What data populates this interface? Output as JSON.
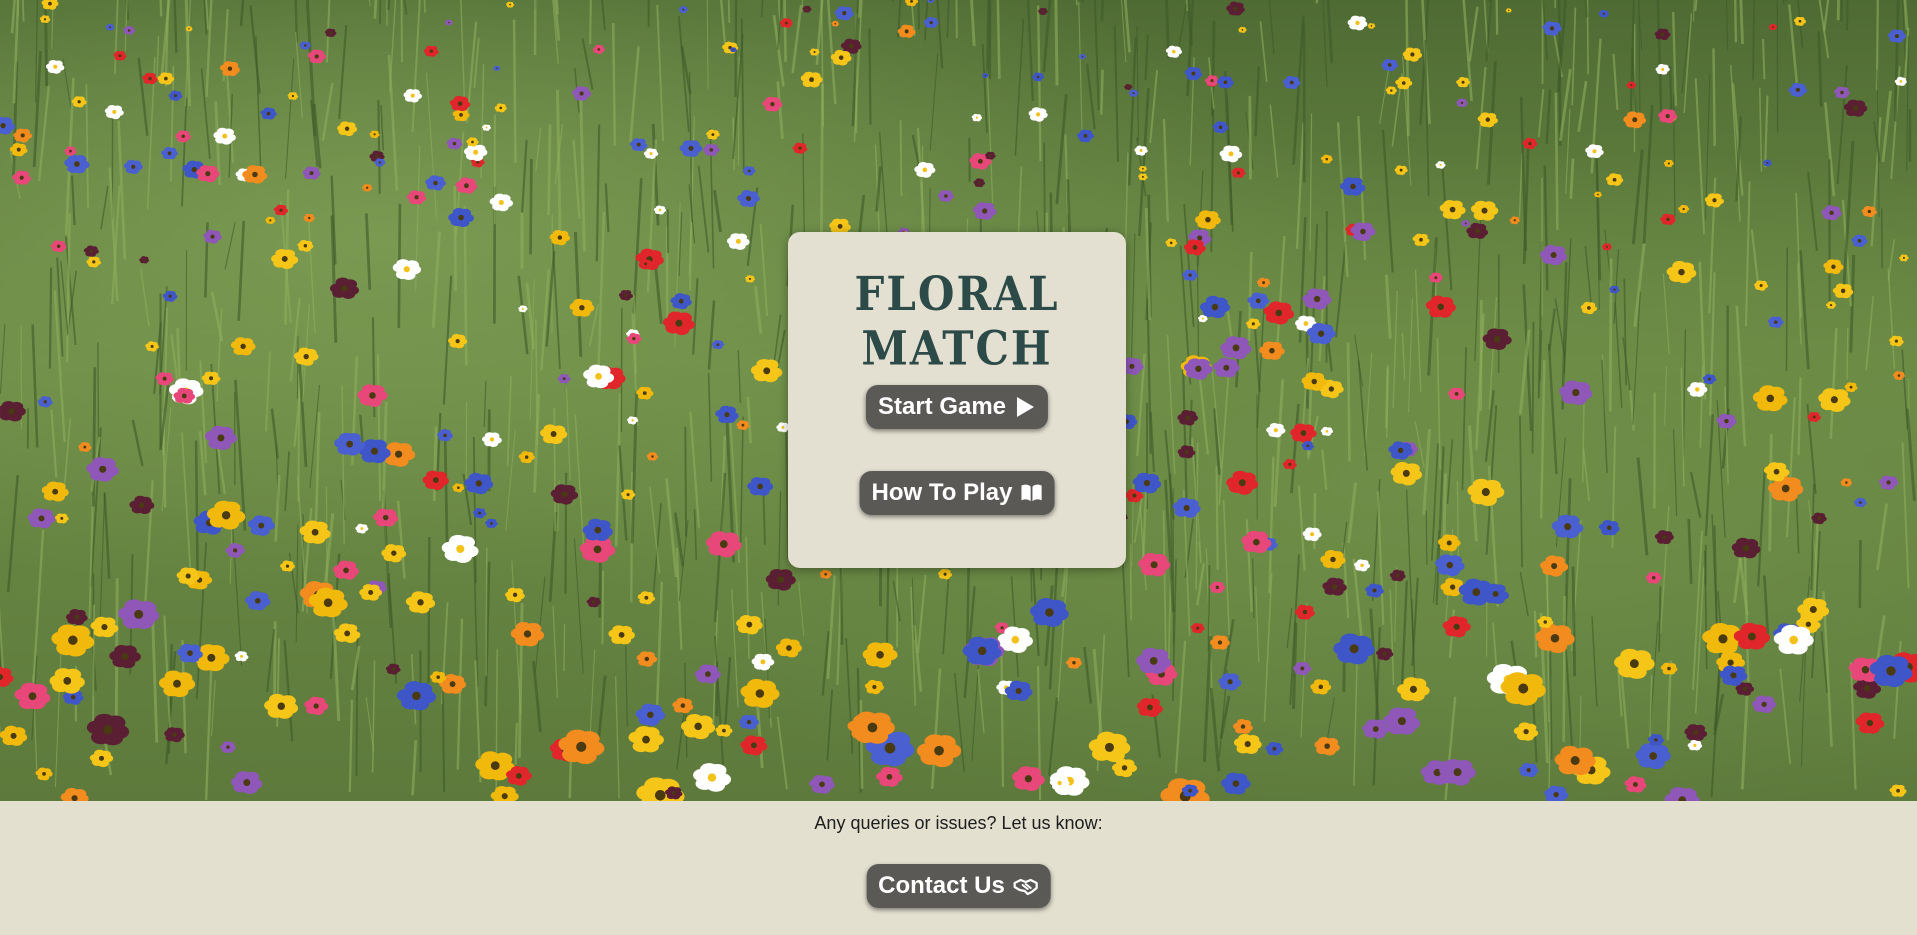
{
  "game": {
    "title": "FLORAL MATCH",
    "start_label": "Start Game",
    "start_icon": "play-icon",
    "howto_label": "How To Play",
    "howto_icon": "book-icon"
  },
  "footer": {
    "text": "Any queries or issues? Let us know:",
    "contact_label": "Contact Us",
    "contact_icon": "handshake-icon"
  },
  "colors": {
    "card_bg": "#e3dfd1",
    "title": "#2c4a48",
    "button_bg": "#5b5956",
    "footer_bg": "#e4e0d0"
  },
  "background": {
    "description_icon": "wildflower-meadow-image"
  }
}
